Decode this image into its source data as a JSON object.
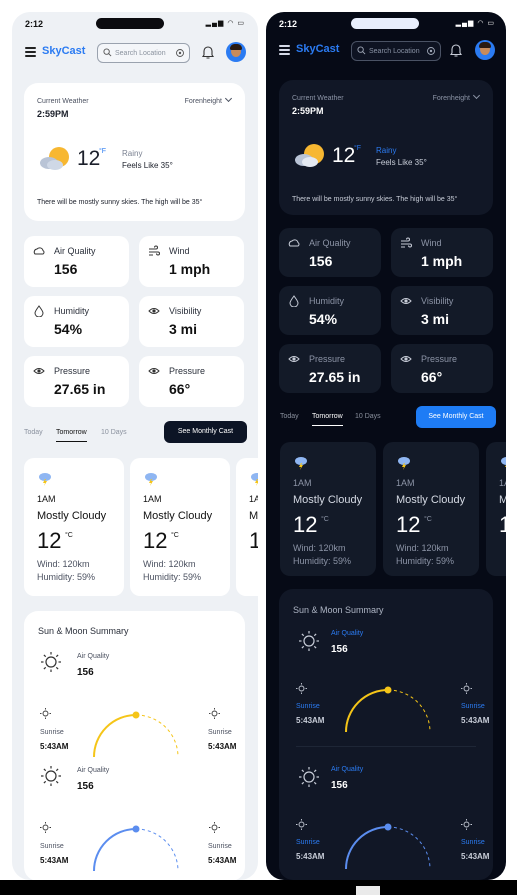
{
  "status": {
    "time": "2:12"
  },
  "header": {
    "brand": "SkyCast",
    "search_placeholder": "Search Location"
  },
  "current": {
    "label": "Current Weather",
    "time": "2:59PM",
    "unit_selector": "Forenheight",
    "temp": "12",
    "temp_unit": "°F",
    "condition": "Rainy",
    "feels_like": "Feels Like 35°",
    "description": "There will be mostly sunny skies. The high will be 35°"
  },
  "stats": [
    {
      "label": "Air Quality",
      "value": "156",
      "icon": "air-quality-icon"
    },
    {
      "label": "Wind",
      "value": "1 mph",
      "icon": "wind-icon"
    },
    {
      "label": "Humidity",
      "value": "54%",
      "icon": "humidity-icon"
    },
    {
      "label": "Visibility",
      "value": "3 mi",
      "icon": "eye-icon"
    },
    {
      "label": "Pressure",
      "value": "27.65 in",
      "icon": "eye-icon"
    },
    {
      "label": "Pressure",
      "value": "66°",
      "icon": "eye-icon"
    }
  ],
  "tabs": {
    "today": "Today",
    "tomorrow": "Tomorrow",
    "ten_days": "10 Days",
    "monthly_button": "See Monthly Cast"
  },
  "forecast": {
    "hour": "1AM",
    "condition": "Mostly Cloudy",
    "temp": "12",
    "unit": "°C",
    "wind": "Wind: 120km",
    "humidity": "Humidity: 59%",
    "peek_hour": "1A",
    "peek_condition": "M",
    "peek_temp": "1"
  },
  "sun_moon": {
    "title": "Sun & Moon Summary",
    "air_quality_label": "Air Quality",
    "air_quality_value": "156",
    "sunrise_label": "Sunrise",
    "sunrise_time": "5:43AM"
  },
  "colors": {
    "accent": "#2b7bf2",
    "sun_arc": "#f5c518",
    "moon_arc": "#5b8def",
    "dark_bg": "#060a16"
  }
}
